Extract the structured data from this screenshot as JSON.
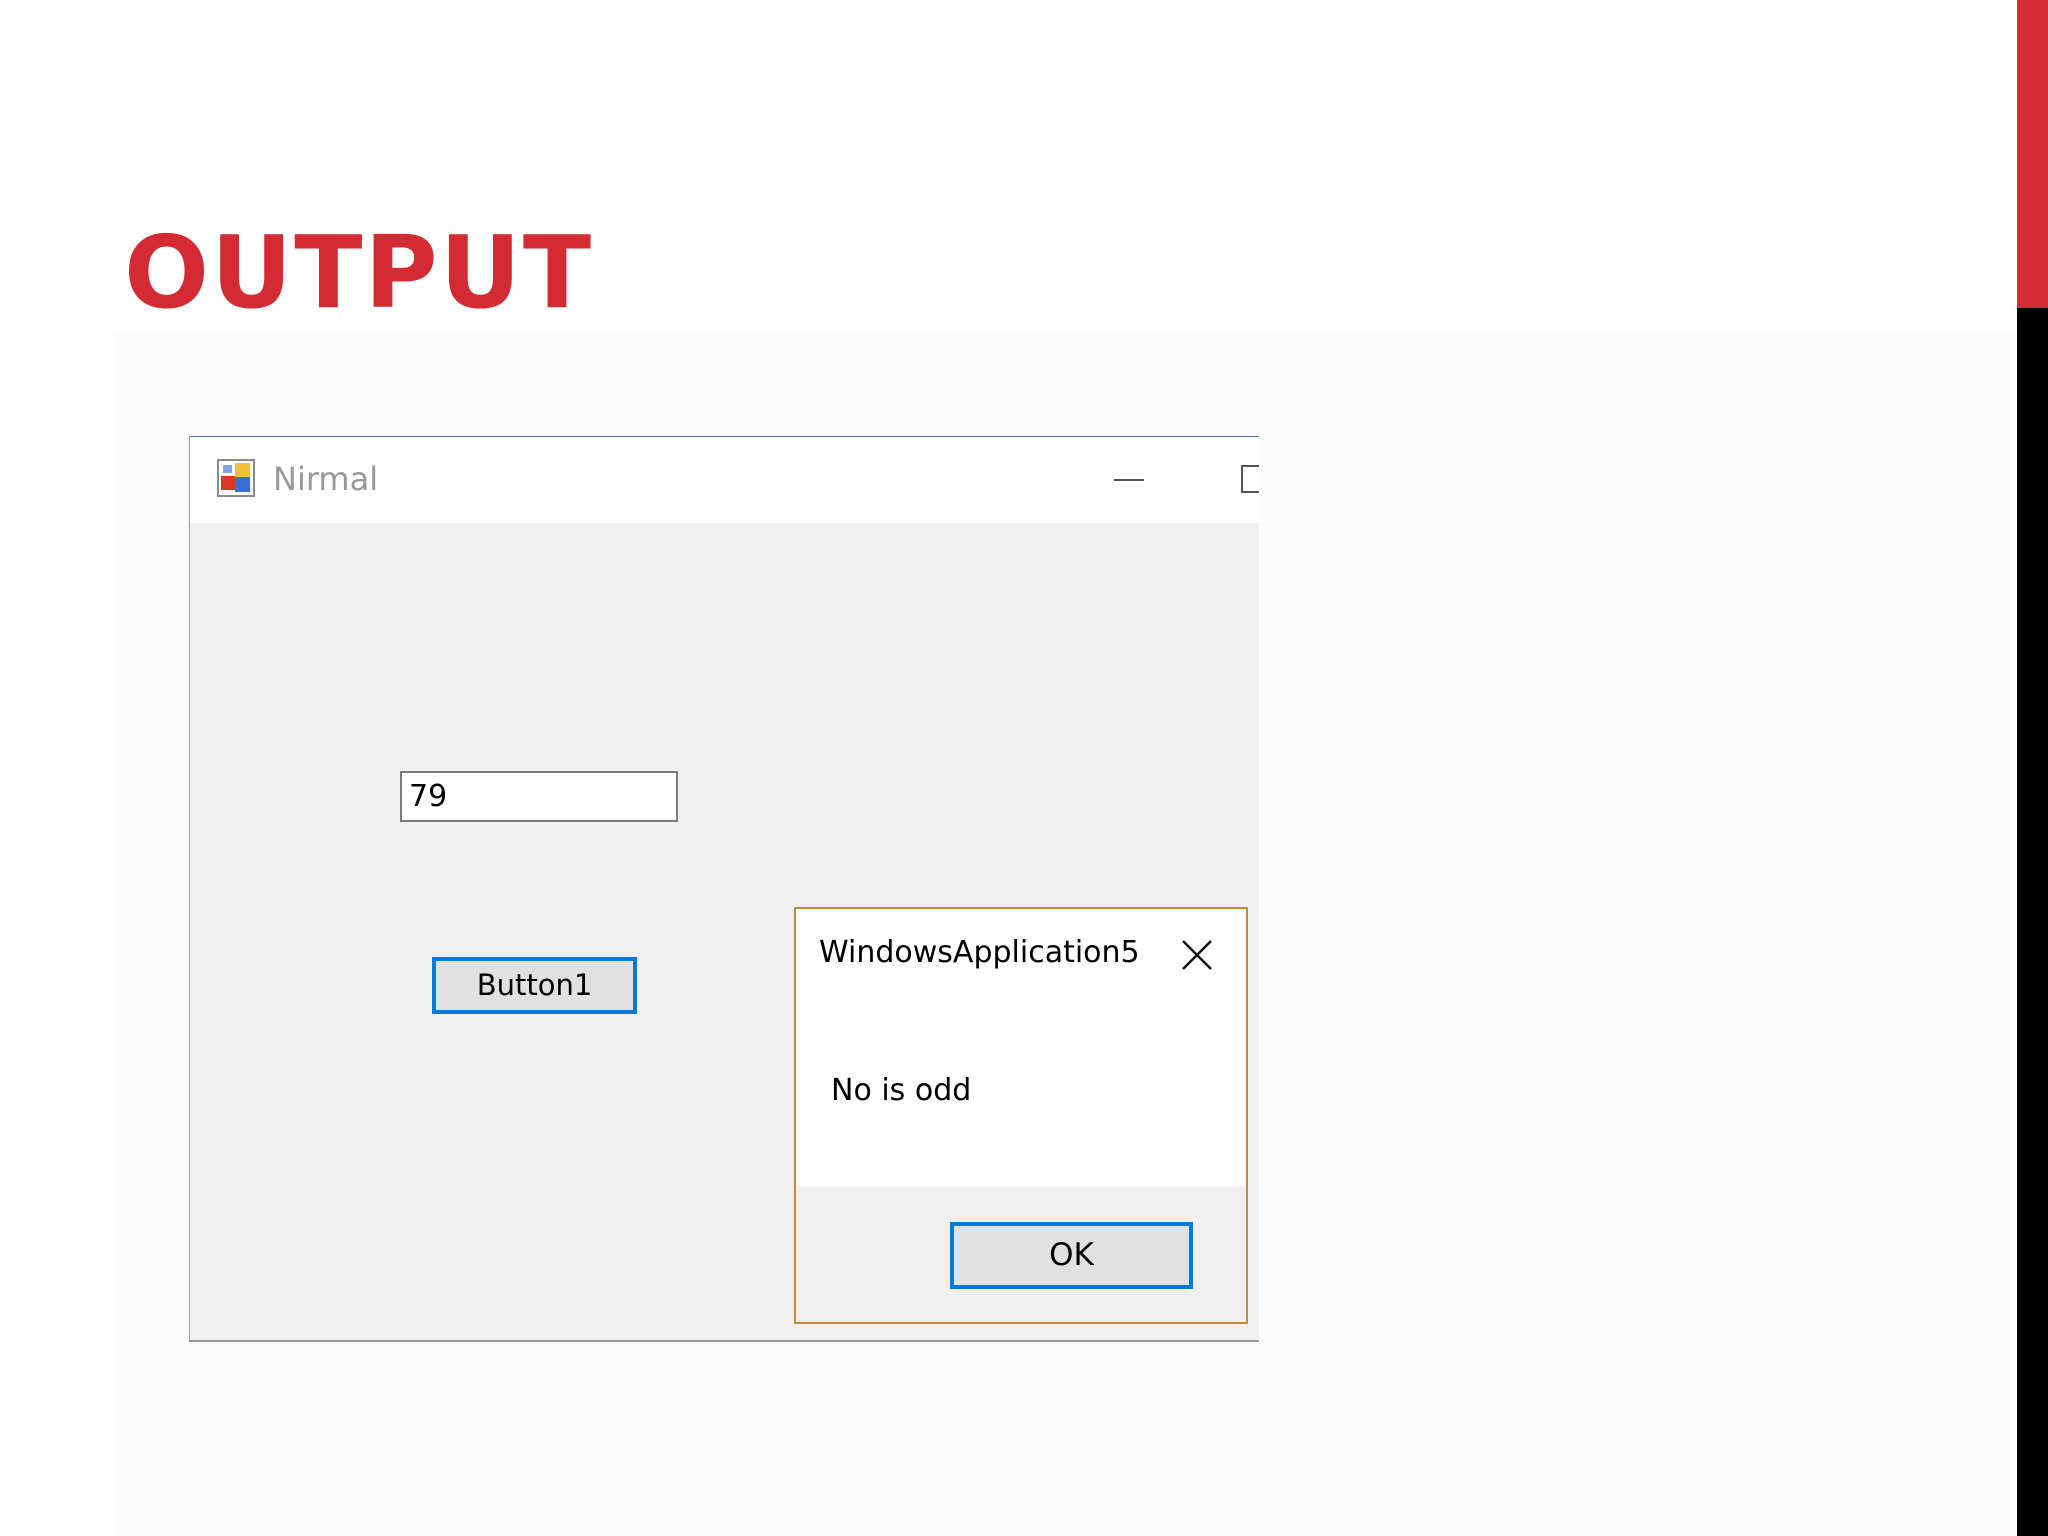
{
  "slide": {
    "title": "OUTPUT",
    "accent_color": "#d42a34"
  },
  "window": {
    "title": "Nirmal",
    "icons": {
      "app": "winforms-app-icon",
      "minimize": "minimize-icon",
      "maximize": "maximize-icon",
      "close": "close-icon"
    },
    "textbox_value": "79",
    "button_label": "Button1"
  },
  "messagebox": {
    "title": "WindowsApplication5",
    "message": "No is odd",
    "ok_label": "OK",
    "close_icon": "close-icon"
  }
}
